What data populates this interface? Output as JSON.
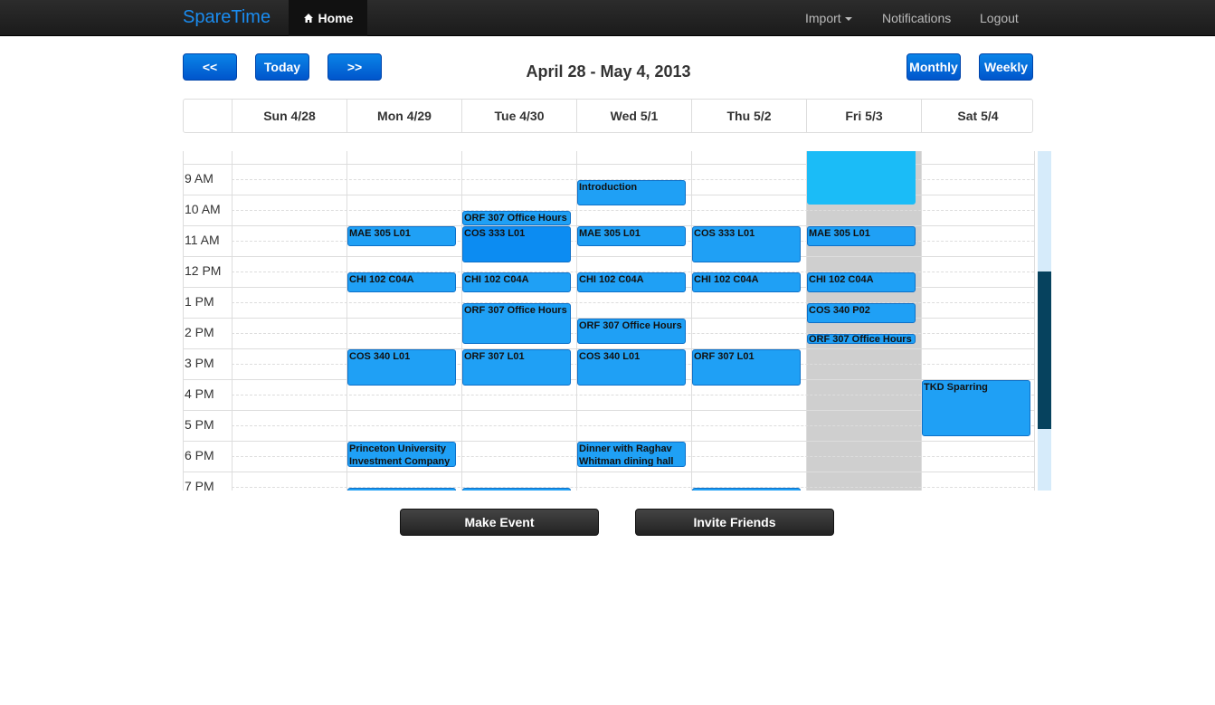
{
  "navbar": {
    "brand": "SpareTime",
    "home_label": "Home",
    "import_label": "Import",
    "notifications_label": "Notifications",
    "logout_label": "Logout"
  },
  "toolbar": {
    "prev_label": "<<",
    "today_label": "Today",
    "next_label": ">>",
    "week_title": "April 28 - May 4, 2013",
    "monthly_label": "Monthly",
    "weekly_label": "Weekly"
  },
  "days": [
    "Sun 4/28",
    "Mon 4/29",
    "Tue 4/30",
    "Wed 5/1",
    "Thu 5/2",
    "Fri 5/3",
    "Sat 5/4"
  ],
  "hours": [
    "9 AM",
    "10 AM",
    "11 AM",
    "12 PM",
    "1 PM",
    "2 PM",
    "3 PM",
    "4 PM",
    "5 PM",
    "6 PM",
    "7 PM"
  ],
  "events": {
    "mon_mae": "MAE 305 L01",
    "mon_chi": "CHI 102 C04A",
    "mon_cos340": "COS 340 L01",
    "mon_piic": "Princeton University\nInvestment Company",
    "tue_orf_oh1": "ORF 307 Office Hours",
    "tue_cos333": "COS 333 L01",
    "tue_chi": "CHI 102 C04A",
    "tue_orf_oh2": "ORF 307 Office Hours",
    "tue_orf307": "ORF 307 L01",
    "wed_intro": "Introduction",
    "wed_mae": "MAE 305 L01",
    "wed_chi": "CHI 102 C04A",
    "wed_orf_oh": "ORF 307 Office Hours",
    "wed_cos340": "COS 340 L01",
    "wed_dinner": "Dinner with Raghav\nWhitman dining hall",
    "thu_cos333": "COS 333 L01",
    "thu_chi": "CHI 102 C04A",
    "thu_orf307": "ORF 307 L01",
    "fri_mae": "MAE 305 L01",
    "fri_chi": "CHI 102 C04A",
    "fri_cos340": "COS 340 P02",
    "fri_orf_oh": "ORF 307 Office Hours",
    "sat_tkd": "TKD Sparring"
  },
  "actions": {
    "make_event_label": "Make Event",
    "invite_friends_label": "Invite Friends"
  }
}
